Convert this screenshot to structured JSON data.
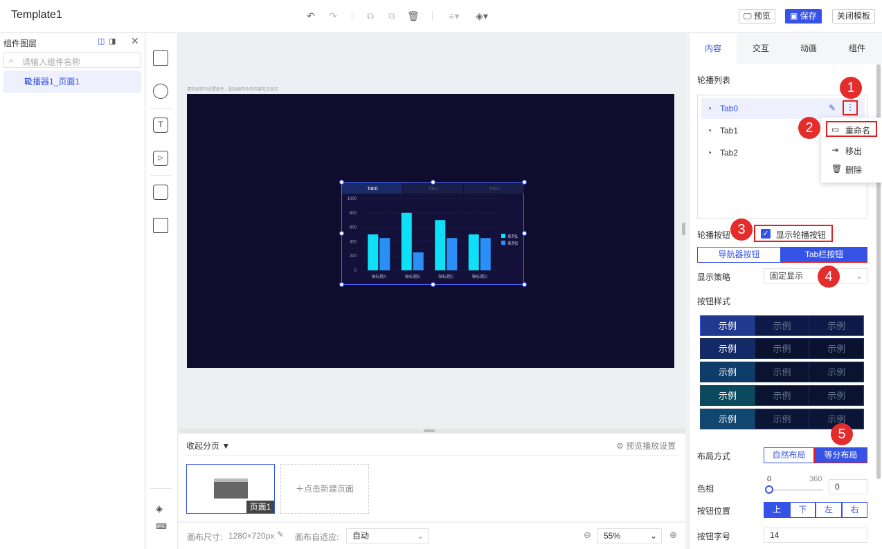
{
  "app": {
    "title": "Template1"
  },
  "toolbar": {
    "preview": "预览",
    "save": "保存",
    "close": "关闭模板"
  },
  "left": {
    "header": "组件图层",
    "search_placeholder": "请输入组件名称",
    "layer_item": "轮播器1_页面1"
  },
  "canvas": {
    "note": "请在画布内设置组件，超出画布外的内容无法显示"
  },
  "chart_data": {
    "type": "bar",
    "tabs": [
      "Tab0",
      "Tab1",
      "Tab2"
    ],
    "categories": [
      "轴标题A",
      "轴标题B",
      "轴标题C",
      "轴标题D"
    ],
    "series": [
      {
        "name": "系列1",
        "values": [
          500,
          800,
          700,
          500
        ],
        "color": "#0ee0f8"
      },
      {
        "name": "系列2",
        "values": [
          450,
          250,
          450,
          450
        ],
        "color": "#2a8ff7"
      }
    ],
    "yticks": [
      "0",
      "200",
      "400",
      "600",
      "800",
      "1000"
    ],
    "ylim": [
      0,
      1000
    ]
  },
  "pages": {
    "collapse": "收起分页",
    "preview_settings": "预览播放设置",
    "page1": "页面1",
    "new_page": "点击新建页面"
  },
  "footer": {
    "size_label": "画布尺寸:",
    "size_value": "1280×720px",
    "adapt_label": "画布自适应:",
    "adapt_value": "自动",
    "zoom": "55%"
  },
  "right": {
    "tabs": [
      "内容",
      "交互",
      "动画",
      "组件"
    ],
    "list_label": "轮播列表",
    "list_items": [
      "Tab0",
      "Tab1",
      "Tab2"
    ],
    "menu": [
      "重命名",
      "移出",
      "删除"
    ],
    "carousel_btn_label": "轮播按钮",
    "show_btn": "显示轮播按钮",
    "nav_btn": "导航器按钮",
    "tab_btn": "Tab栏按钮",
    "display_label": "显示策略",
    "display_value": "固定显示",
    "style_label": "按钮样式",
    "style_sample": "示例",
    "layout_label": "布局方式",
    "layout_natural": "自然布局",
    "layout_equal": "等分布局",
    "hue_label": "色相",
    "hue_min": "0",
    "hue_max": "360",
    "hue_value": "0",
    "pos_label": "按钮位置",
    "pos_options": [
      "上",
      "下",
      "左",
      "右"
    ],
    "font_label": "按钮字号",
    "font_value": "14"
  },
  "badges": [
    "1",
    "2",
    "3",
    "4",
    "5"
  ]
}
